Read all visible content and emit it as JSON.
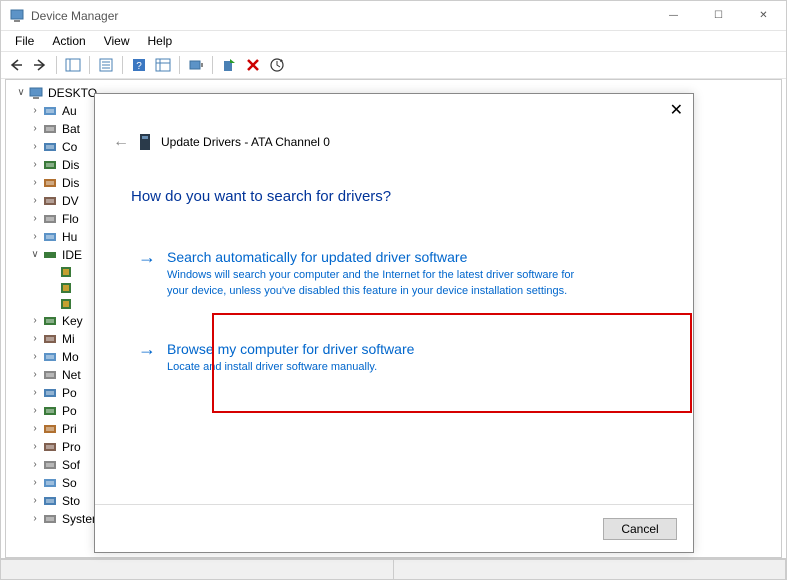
{
  "window": {
    "title": "Device Manager",
    "controls": {
      "min": "—",
      "max": "☐",
      "close": "✕"
    }
  },
  "menu": {
    "file": "File",
    "action": "Action",
    "view": "View",
    "help": "Help"
  },
  "tree": {
    "root": "DESKTO",
    "nodes": [
      {
        "label": "Au"
      },
      {
        "label": "Bat"
      },
      {
        "label": "Co"
      },
      {
        "label": "Dis"
      },
      {
        "label": "Dis"
      },
      {
        "label": "DV"
      },
      {
        "label": "Flo"
      },
      {
        "label": "Hu"
      }
    ],
    "ide_label": "IDE",
    "ide_children": [
      "",
      "",
      ""
    ],
    "nodes2": [
      {
        "label": "Key"
      },
      {
        "label": "Mi"
      },
      {
        "label": "Mo"
      },
      {
        "label": "Net"
      },
      {
        "label": "Po"
      },
      {
        "label": "Po"
      },
      {
        "label": "Pri"
      },
      {
        "label": "Pro"
      },
      {
        "label": "Sof"
      },
      {
        "label": "So"
      },
      {
        "label": "Sto"
      },
      {
        "label": "System devices"
      }
    ]
  },
  "dialog": {
    "title": "Update Drivers - ATA Channel 0",
    "heading": "How do you want to search for drivers?",
    "opt1_title": "Search automatically for updated driver software",
    "opt1_desc": "Windows will search your computer and the Internet for the latest driver software for your device, unless you've disabled this feature in your device installation settings.",
    "opt2_title": "Browse my computer for driver software",
    "opt2_desc": "Locate and install driver software manually.",
    "cancel": "Cancel"
  }
}
